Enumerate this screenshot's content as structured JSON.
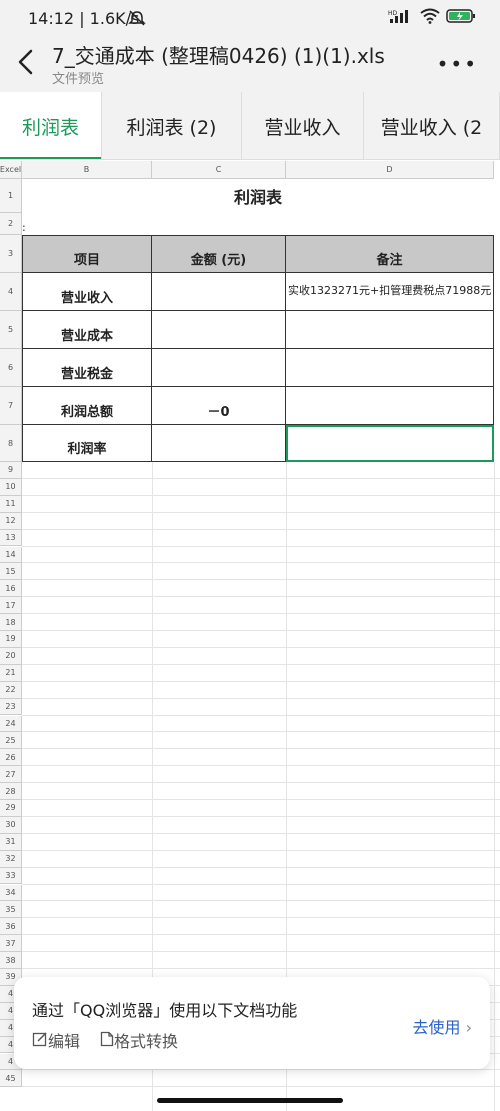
{
  "status": {
    "time": "14:12 | 1.6K/s",
    "hd": "HD"
  },
  "title_bar": {
    "title": "7_交通成本 (整理稿0426) (1)(1).xls",
    "subtitle": "文件预览"
  },
  "tabs": [
    {
      "label": "利润表"
    },
    {
      "label": "利润表 (2)"
    },
    {
      "label": "营业收入"
    },
    {
      "label": "营业收入 (2"
    }
  ],
  "sheet": {
    "corner": "Excel",
    "columns": [
      "B",
      "C",
      "D"
    ],
    "title": "利润表",
    "colon": ":",
    "header": {
      "item": "项目",
      "amount": "金额 (元)",
      "note": "备注"
    },
    "rows": [
      {
        "num": "4",
        "item": "营业收入",
        "amount": "",
        "note": "实收1323271元+扣管理费税点71988元"
      },
      {
        "num": "5",
        "item": "营业成本",
        "amount": "",
        "note": ""
      },
      {
        "num": "6",
        "item": "营业税金",
        "amount": "",
        "note": ""
      },
      {
        "num": "7",
        "item": "利润总额",
        "amount": "－0",
        "note": ""
      },
      {
        "num": "8",
        "item": "利润率",
        "amount": "",
        "note": ""
      }
    ],
    "row_numbers": [
      "1",
      "2",
      "3",
      "4",
      "5",
      "6",
      "7",
      "8",
      "9",
      "10",
      "11",
      "12",
      "13",
      "14",
      "15",
      "16",
      "17",
      "18",
      "19",
      "20",
      "21",
      "22",
      "23",
      "24",
      "25",
      "26",
      "27",
      "28",
      "29",
      "30",
      "31",
      "32",
      "33",
      "34",
      "35",
      "36",
      "37",
      "38",
      "39",
      "4",
      "4",
      "4",
      "4",
      "4",
      "45"
    ]
  },
  "banner": {
    "text": "通过「QQ浏览器」使用以下文档功能",
    "edit": "编辑",
    "convert": "格式转换",
    "go": "去使用"
  }
}
